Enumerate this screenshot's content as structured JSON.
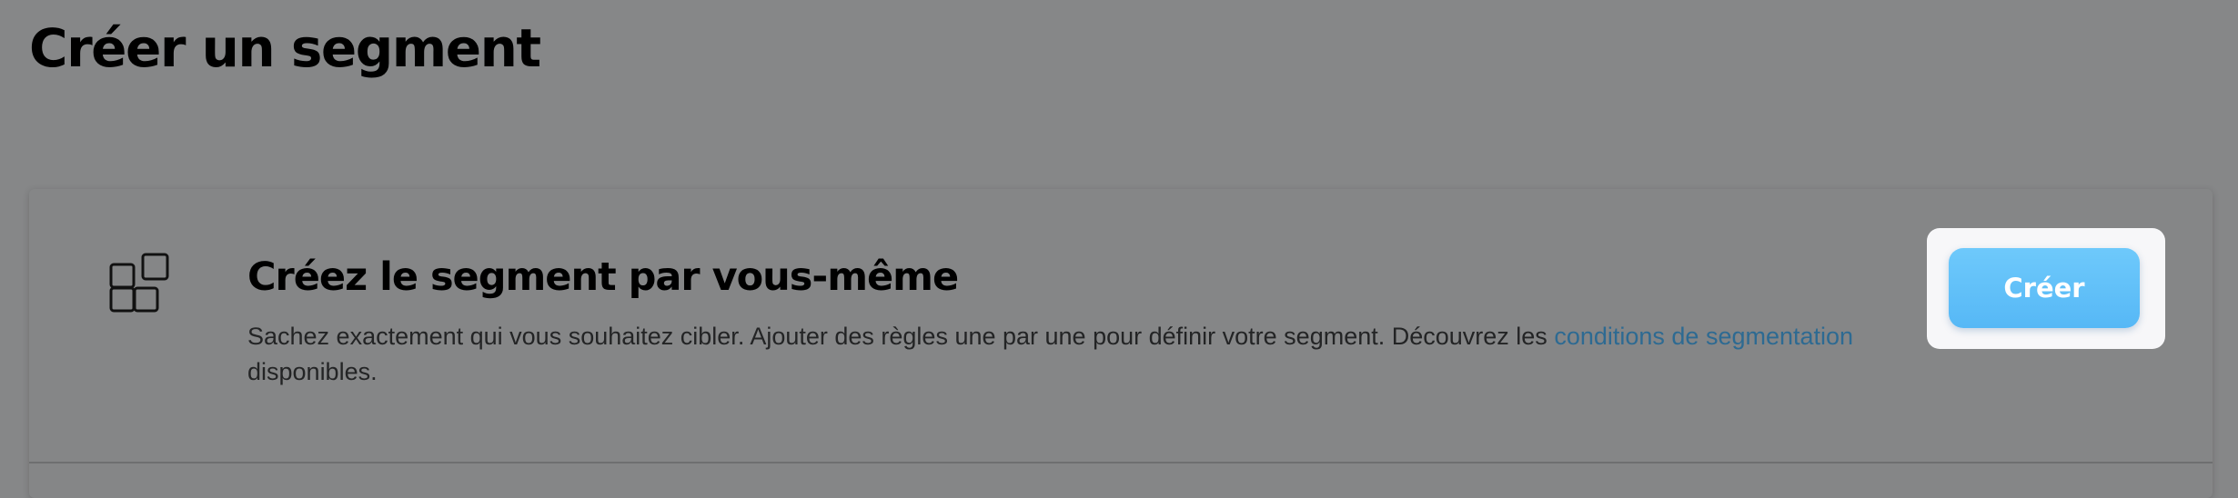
{
  "page": {
    "title": "Créer un segment"
  },
  "card": {
    "icon": "blocks-icon",
    "title": "Créez le segment par vous-même",
    "description": "Sachez exactement qui vous souhaitez cibler. Ajouter des règles une par une pour définir votre segment. Découvrez les ",
    "link_text": "conditions de segmentation",
    "description_end": " disponibles.",
    "button_label": "Créer"
  },
  "colors": {
    "overlay_background": "#868788",
    "link": "#2d6a92",
    "button": "#5bbdf8",
    "button_highlight": "#f7f7f9"
  }
}
